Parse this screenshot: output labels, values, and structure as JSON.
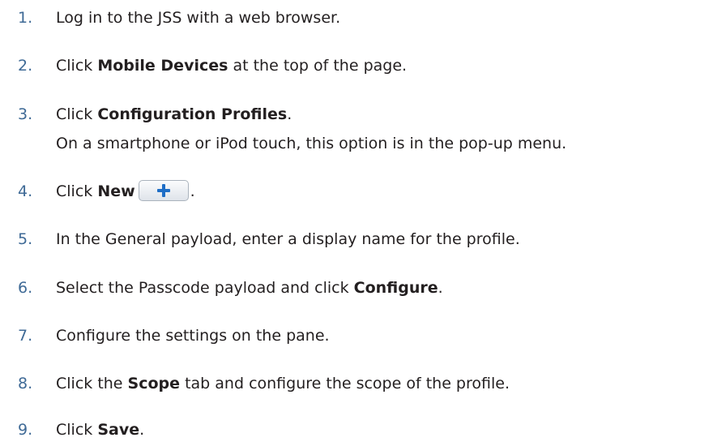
{
  "colors": {
    "step_number": "#3f6a96",
    "body_text": "#231f20",
    "button_plus": "#1f6ec6"
  },
  "steps": [
    {
      "number": "1.",
      "text": "Log in to the JSS with a web browser."
    },
    {
      "number": "2.",
      "pre": "Click ",
      "bold": "Mobile Devices",
      "post": " at the top of the page."
    },
    {
      "number": "3.",
      "pre": "Click ",
      "bold": "Configuration Profiles",
      "post": ".",
      "note": "On a smartphone or iPod touch, this option is in the pop-up menu."
    },
    {
      "number": "4.",
      "pre": "Click ",
      "bold": "New",
      "button_icon": "plus-icon",
      "post": "."
    },
    {
      "number": "5.",
      "text": "In the General payload, enter a display name for the profile."
    },
    {
      "number": "6.",
      "pre": "Select the Passcode payload and click ",
      "bold": "Configure",
      "post": "."
    },
    {
      "number": "7.",
      "text": "Configure the settings on the pane."
    },
    {
      "number": "8.",
      "pre": "Click the ",
      "bold": "Scope",
      "post": " tab and configure the scope of the profile."
    },
    {
      "number": "9.",
      "pre": "Click ",
      "bold": "Save",
      "post": "."
    }
  ]
}
